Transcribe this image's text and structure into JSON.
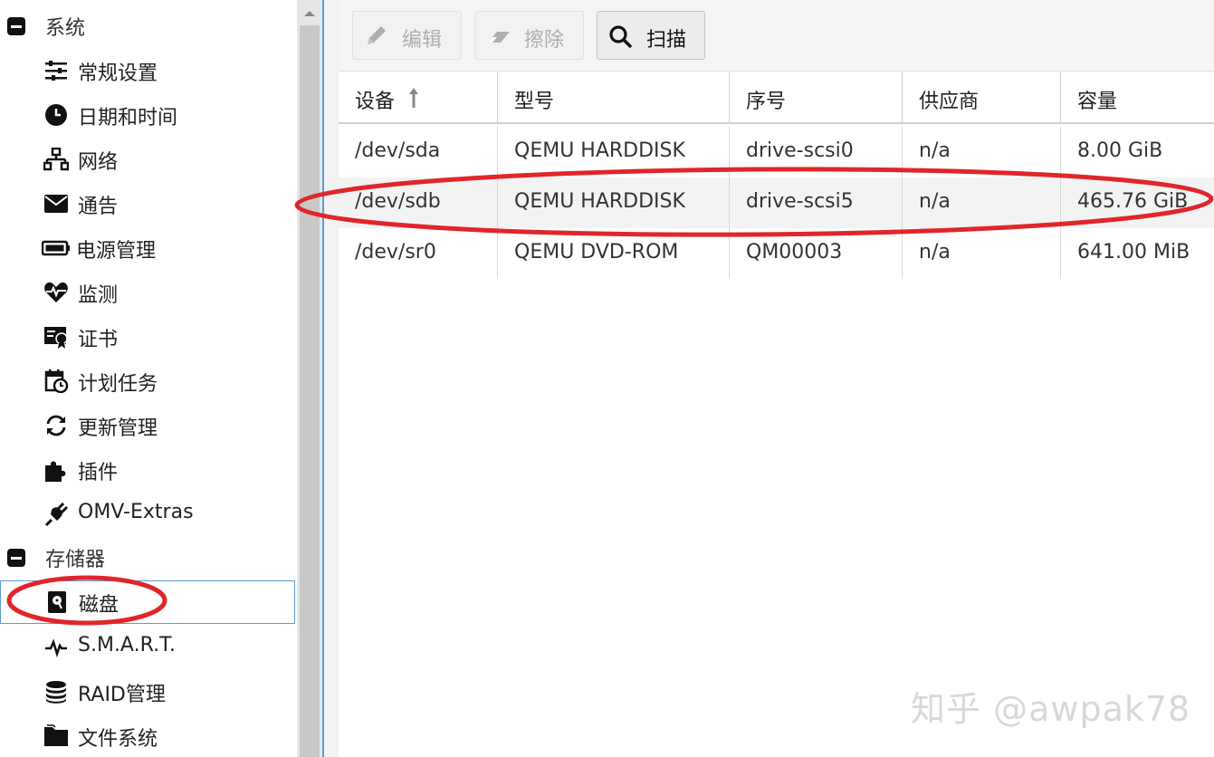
{
  "sidebar": {
    "groups": [
      {
        "label": "系统",
        "toggle_icon": "minus-square-icon"
      },
      {
        "label": "存储器",
        "toggle_icon": "minus-square-icon"
      }
    ],
    "system_items": [
      {
        "label": "常规设置",
        "icon": "sliders-icon"
      },
      {
        "label": "日期和时间",
        "icon": "clock-icon"
      },
      {
        "label": "网络",
        "icon": "network-icon"
      },
      {
        "label": "通告",
        "icon": "envelope-icon"
      },
      {
        "label": "电源管理",
        "icon": "battery-icon"
      },
      {
        "label": "监测",
        "icon": "heartbeat-icon"
      },
      {
        "label": "证书",
        "icon": "certificate-icon"
      },
      {
        "label": "计划任务",
        "icon": "calendar-clock-icon"
      },
      {
        "label": "更新管理",
        "icon": "refresh-icon"
      },
      {
        "label": "插件",
        "icon": "puzzle-icon"
      },
      {
        "label": "OMV-Extras",
        "icon": "plug-icon"
      }
    ],
    "storage_items": [
      {
        "label": "磁盘",
        "icon": "harddisk-icon",
        "selected": true
      },
      {
        "label": "S.M.A.R.T.",
        "icon": "pulse-icon"
      },
      {
        "label": "RAID管理",
        "icon": "database-icon"
      },
      {
        "label": "文件系统",
        "icon": "folder-icon"
      }
    ]
  },
  "toolbar": {
    "edit_label": "编辑",
    "wipe_label": "擦除",
    "scan_label": "扫描"
  },
  "grid": {
    "columns": [
      "设备",
      "型号",
      "序号",
      "供应商",
      "容量"
    ],
    "sort_indicator": "arrow-up-icon",
    "rows": [
      [
        "/dev/sda",
        "QEMU HARDDISK",
        "drive-scsi0",
        "n/a",
        "8.00 GiB"
      ],
      [
        "/dev/sdb",
        "QEMU HARDDISK",
        "drive-scsi5",
        "n/a",
        "465.76 GiB"
      ],
      [
        "/dev/sr0",
        "QEMU DVD-ROM",
        "QM00003",
        "n/a",
        "641.00 MiB"
      ]
    ]
  },
  "annotation_color": "#e0262b",
  "selection_border_color": "#5b9bd5",
  "watermark": "知乎 @awpak78"
}
